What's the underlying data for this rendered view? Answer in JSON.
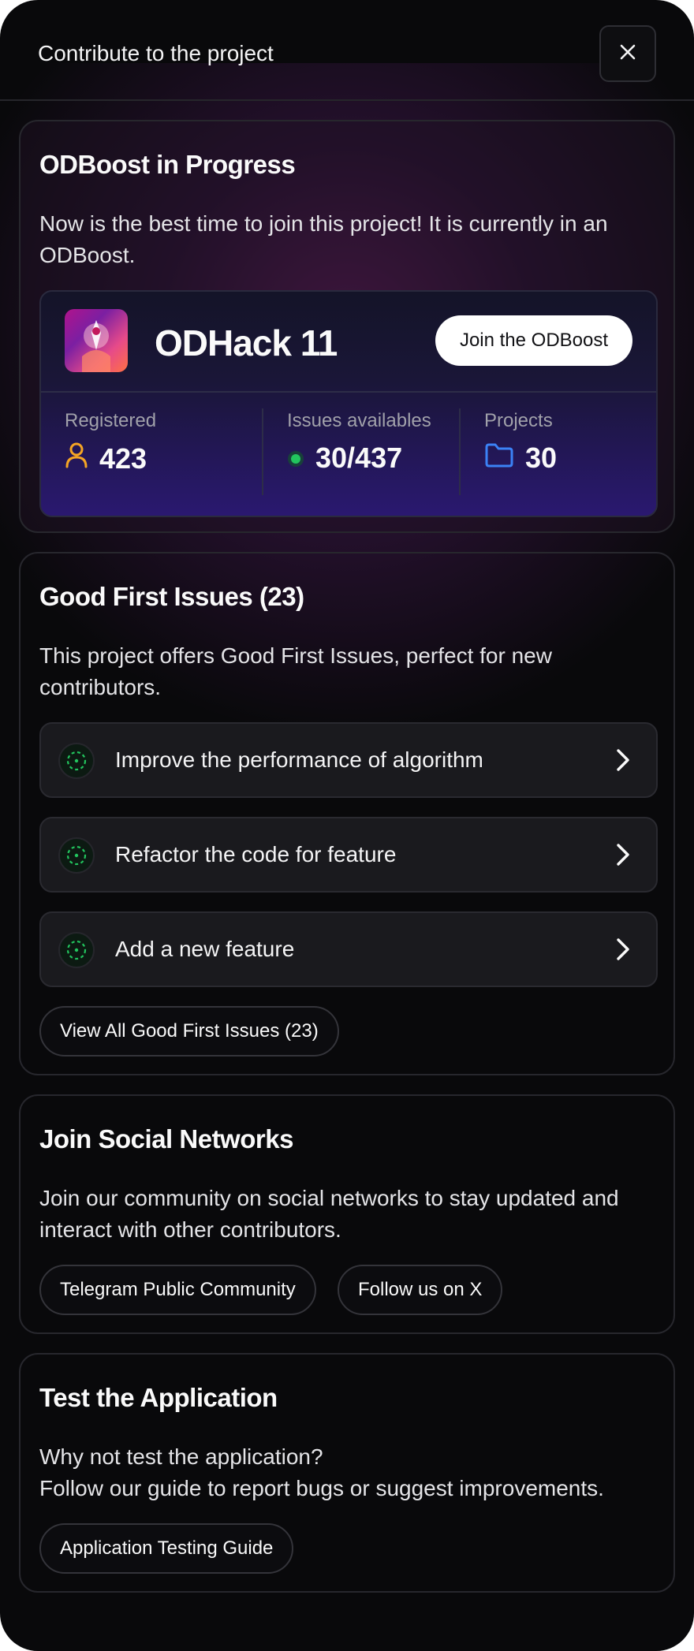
{
  "header": {
    "title": "Contribute to the project"
  },
  "boost": {
    "title": "ODBoost in Progress",
    "text": "Now is the best time to join this project! It is currently in an ODBoost.",
    "hackathon": {
      "name": "ODHack 11",
      "join_label": "Join the ODBoost",
      "stats": [
        {
          "label": "Registered",
          "value": "423",
          "icon": "user-icon"
        },
        {
          "label": "Issues availables",
          "value": "30/437",
          "icon": "status-dot-icon"
        },
        {
          "label": "Projects",
          "value": "30",
          "icon": "folder-icon"
        }
      ]
    }
  },
  "gfi": {
    "title": "Good First Issues (23)",
    "text": "This project offers Good First Issues, perfect for new contributors.",
    "issues": [
      {
        "label": "Improve the performance of algorithm"
      },
      {
        "label": "Refactor the code for feature"
      },
      {
        "label": "Add a new feature"
      }
    ],
    "view_all_label": "View All Good First Issues (23)"
  },
  "social": {
    "title": "Join Social Networks",
    "text": "Join our community on social networks to stay updated and interact with other contributors.",
    "links": [
      {
        "label": "Telegram Public Community"
      },
      {
        "label": "Follow us on X"
      }
    ]
  },
  "test": {
    "title": "Test the Application",
    "text_line1": "Why not test the application?",
    "text_line2": "Follow our guide to report bugs or suggest improvements.",
    "guide_label": "Application Testing Guide"
  },
  "colors": {
    "background": "#09090b",
    "accent_user": "#f5a524",
    "accent_status": "#22c55e",
    "accent_folder": "#3b82f6"
  }
}
